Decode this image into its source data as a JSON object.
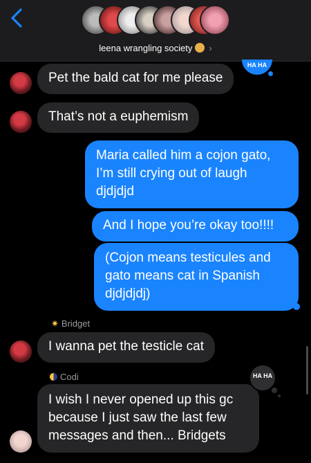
{
  "header": {
    "group_name": "leena wrangling society",
    "back_icon": "chevron-left-icon",
    "title_emoji": "cowboy-emoji",
    "chevron": "›"
  },
  "tapback": {
    "label": "HA HA"
  },
  "messages": [
    {
      "id": "m1",
      "direction": "incoming",
      "text": "Pet the bald cat for me please"
    },
    {
      "id": "m2",
      "direction": "incoming",
      "text": "That’s not a euphemism"
    },
    {
      "id": "m3",
      "direction": "outgoing",
      "lines": [
        "Maria called him a cojon gato,",
        "I’m still crying out of laugh",
        "djdjdjd"
      ]
    },
    {
      "id": "m4",
      "direction": "outgoing",
      "text": "And I hope you’re okay too!!!!"
    },
    {
      "id": "m5",
      "direction": "outgoing",
      "lines": [
        "(Cojon means testicules and",
        "gato means cat in Spanish",
        "djdjdjdj)"
      ]
    },
    {
      "id": "m6",
      "direction": "incoming",
      "sender": "Bridget",
      "text": "I wanna pet the testicle cat"
    },
    {
      "id": "m7",
      "direction": "incoming",
      "sender": "Codi",
      "lines": [
        "I wish I never opened up this gc",
        "because I just saw the last few",
        "messages and then... Bridgets"
      ]
    }
  ],
  "colors": {
    "outgoing": "#1a84ff",
    "incoming": "#262628",
    "background": "#000000"
  }
}
